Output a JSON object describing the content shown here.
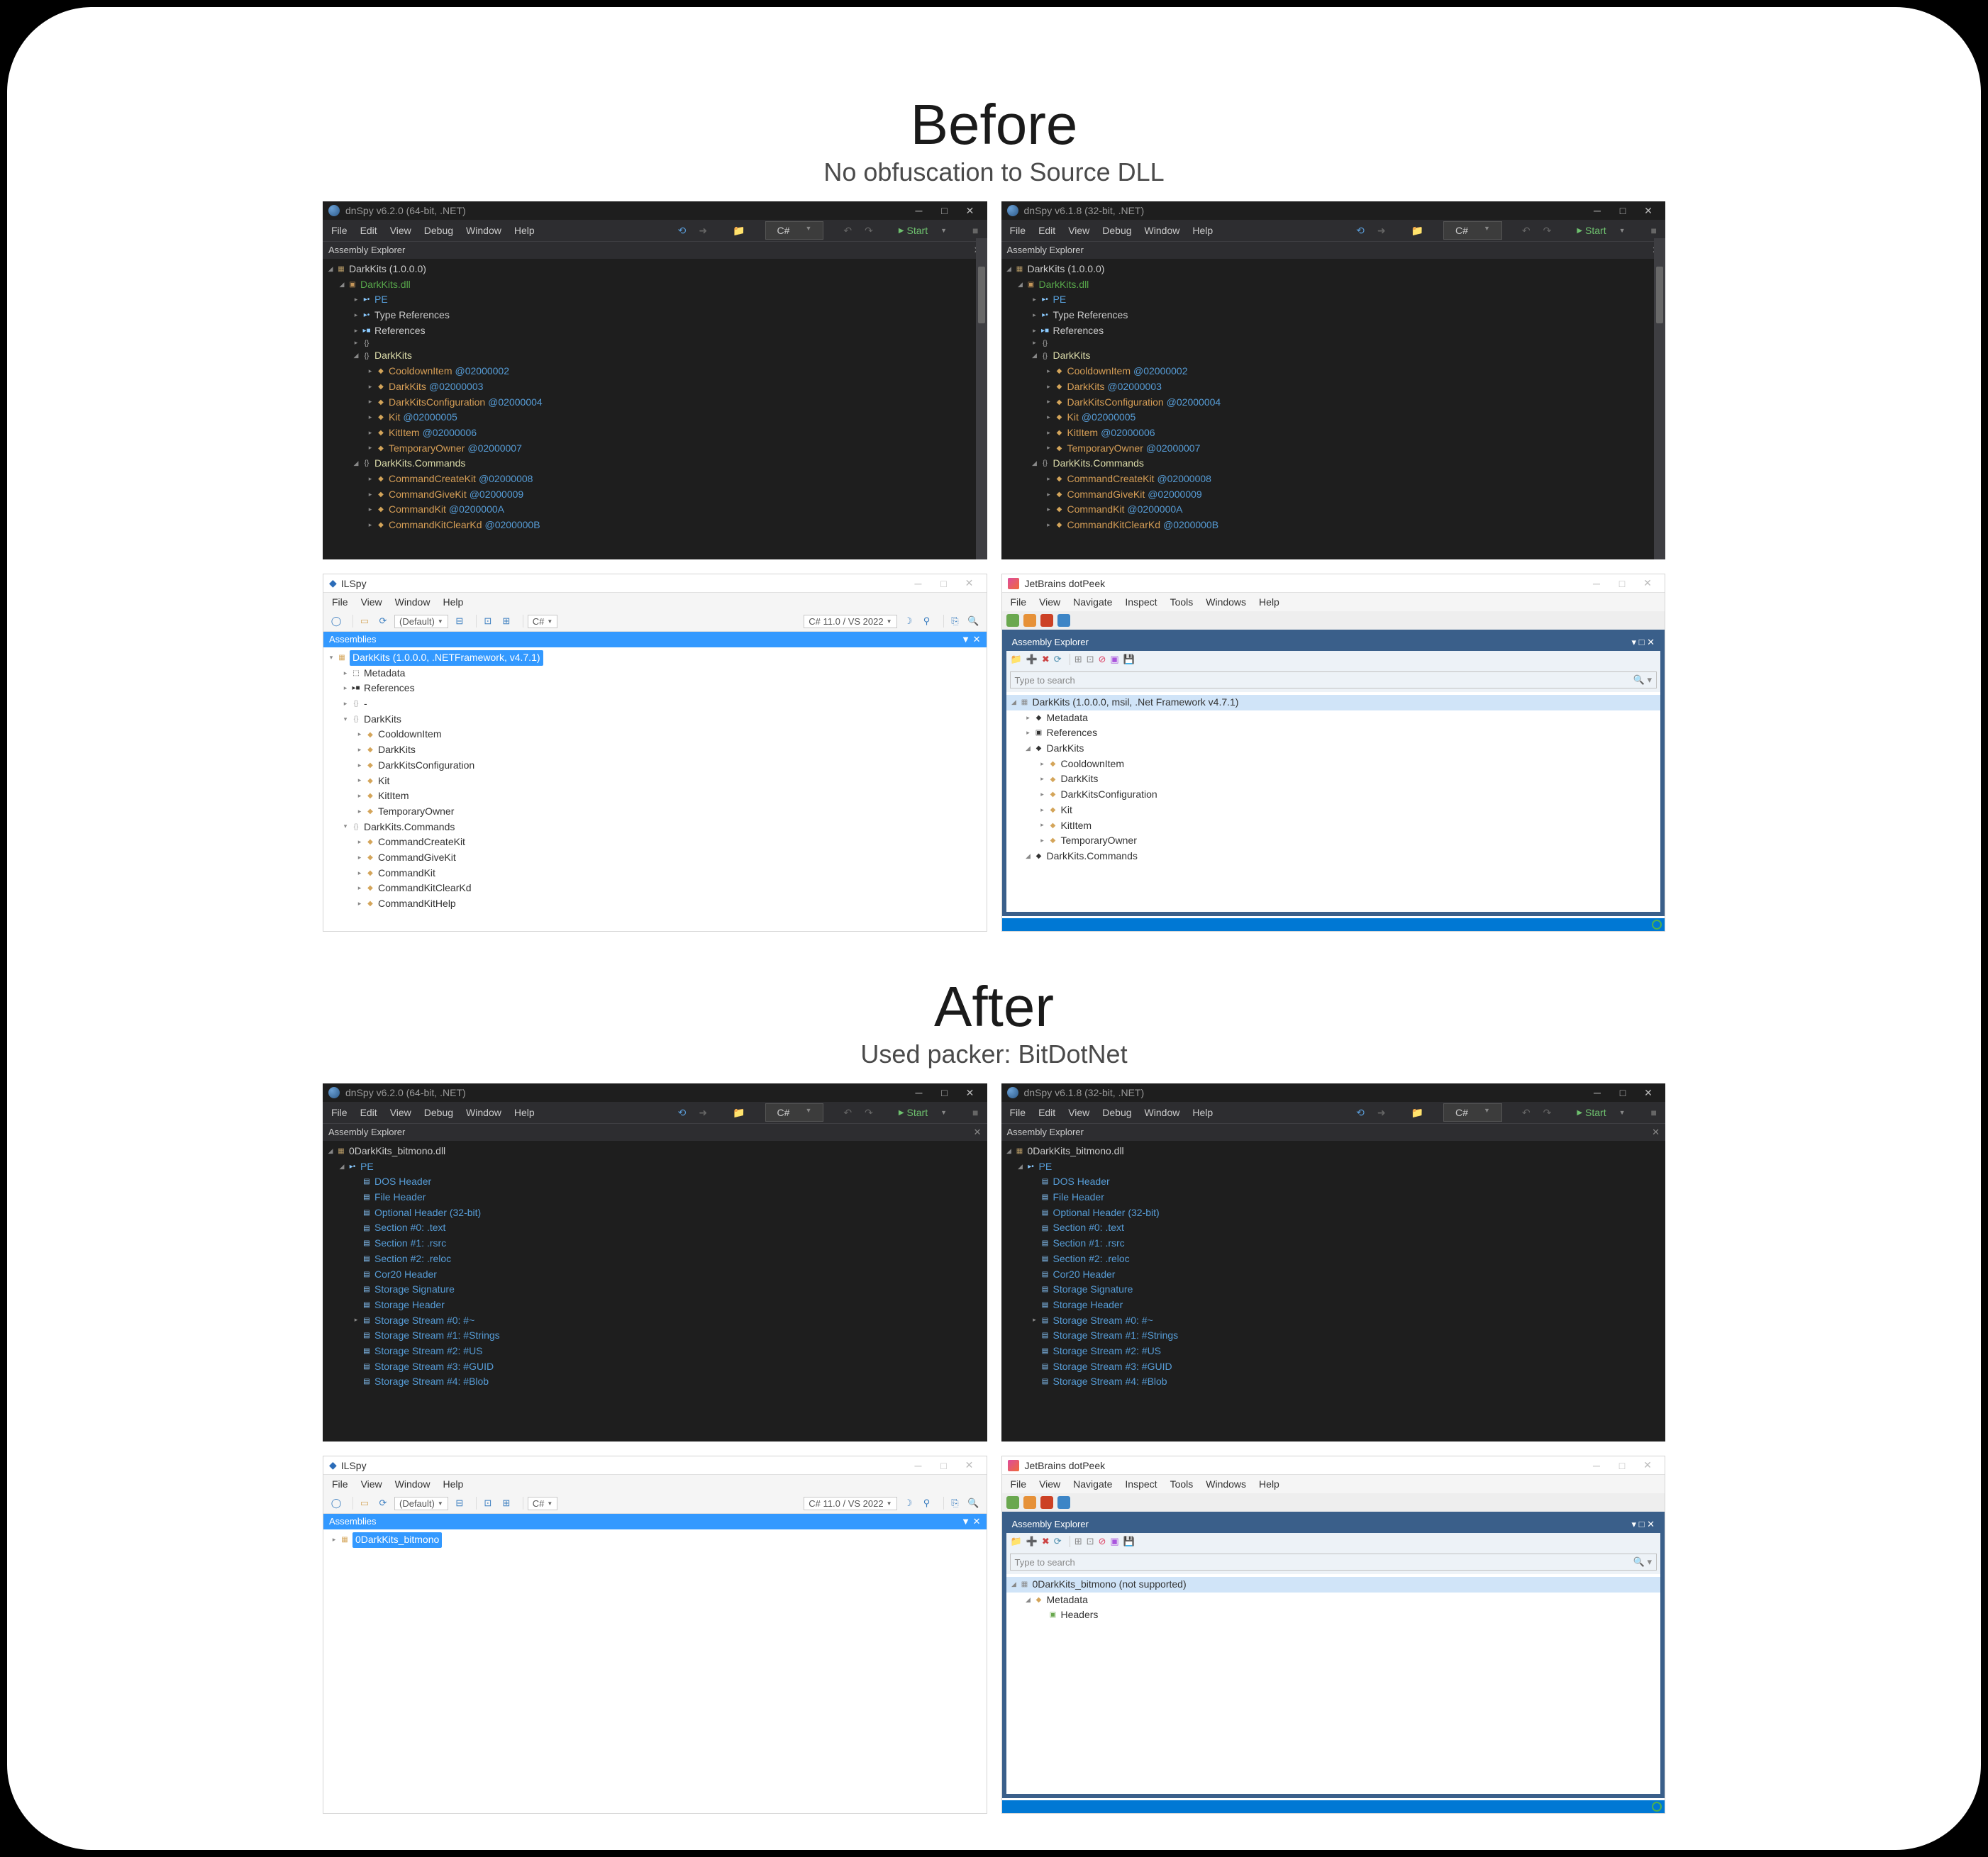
{
  "sections": {
    "before": {
      "title": "Before",
      "subtitle": "No obfuscation to Source DLL"
    },
    "after": {
      "title": "After",
      "subtitle": "Used packer: BitDotNet"
    }
  },
  "dnspy64": {
    "title": "dnSpy v6.2.0 (64-bit, .NET)",
    "menu": [
      "File",
      "Edit",
      "View",
      "Debug",
      "Window",
      "Help"
    ],
    "lang": "C#",
    "start": "Start",
    "panel": "Assembly Explorer",
    "root": "DarkKits (1.0.0.0)",
    "dll": "DarkKits.dll",
    "pe": "PE",
    "typerefs": "Type References",
    "refs": "References",
    "empty_ns": "-",
    "ns1": "DarkKits",
    "cls": [
      {
        "n": "CooldownItem",
        "a": "@02000002"
      },
      {
        "n": "DarkKits",
        "a": "@02000003"
      },
      {
        "n": "DarkKitsConfiguration",
        "a": "@02000004"
      },
      {
        "n": "Kit",
        "a": "@02000005"
      },
      {
        "n": "KitItem",
        "a": "@02000006"
      },
      {
        "n": "TemporaryOwner",
        "a": "@02000007"
      }
    ],
    "ns2": "DarkKits.Commands",
    "cmds": [
      {
        "n": "CommandCreateKit",
        "a": "@02000008"
      },
      {
        "n": "CommandGiveKit",
        "a": "@02000009"
      },
      {
        "n": "CommandKit",
        "a": "@0200000A"
      },
      {
        "n": "CommandKitClearKd",
        "a": "@0200000B"
      }
    ]
  },
  "dnspy32": {
    "title": "dnSpy v6.1.8 (32-bit, .NET)"
  },
  "ilspy": {
    "title": "ILSpy",
    "menu": [
      "File",
      "View",
      "Window",
      "Help"
    ],
    "default": "(Default)",
    "lang": "C#",
    "target": "C# 11.0 / VS 2022",
    "panel": "Assemblies",
    "root": "DarkKits (1.0.0.0, .NETFramework, v4.7.1)",
    "meta": "Metadata",
    "refs": "References",
    "empty": "-",
    "ns1": "DarkKits",
    "cls": [
      "CooldownItem",
      "DarkKits",
      "DarkKitsConfiguration",
      "Kit",
      "KitItem",
      "TemporaryOwner"
    ],
    "ns2": "DarkKits.Commands",
    "cmds": [
      "CommandCreateKit",
      "CommandGiveKit",
      "CommandKit",
      "CommandKitClearKd",
      "CommandKitHelp"
    ]
  },
  "dotpeek": {
    "title": "JetBrains dotPeek",
    "menu": [
      "File",
      "View",
      "Navigate",
      "Inspect",
      "Tools",
      "Windows",
      "Help"
    ],
    "panel": "Assembly Explorer",
    "search": "Type to search",
    "root": "DarkKits (1.0.0.0, msil, .Net Framework v4.7.1)",
    "meta": "Metadata",
    "refs": "References",
    "ns1": "DarkKits",
    "cls": [
      "CooldownItem",
      "DarkKits",
      "DarkKitsConfiguration",
      "Kit",
      "KitItem",
      "TemporaryOwner"
    ],
    "ns2": "DarkKits.Commands"
  },
  "dnspy_after": {
    "root": "0DarkKits_bitmono.dll",
    "pe": "PE",
    "items": [
      "DOS Header",
      "File Header",
      "Optional Header (32-bit)",
      "Section #0: .text",
      "Section #1: .rsrc",
      "Section #2: .reloc",
      "Cor20 Header",
      "Storage Signature",
      "Storage Header"
    ],
    "stream0": "Storage Stream #0: #~",
    "streams": [
      "Storage Stream #1: #Strings",
      "Storage Stream #2: #US",
      "Storage Stream #3: #GUID",
      "Storage Stream #4: #Blob"
    ]
  },
  "ilspy_after": {
    "root": "0DarkKits_bitmono"
  },
  "dotpeek_after": {
    "root": "0DarkKits_bitmono (not supported)",
    "meta": "Metadata",
    "headers": "Headers"
  }
}
